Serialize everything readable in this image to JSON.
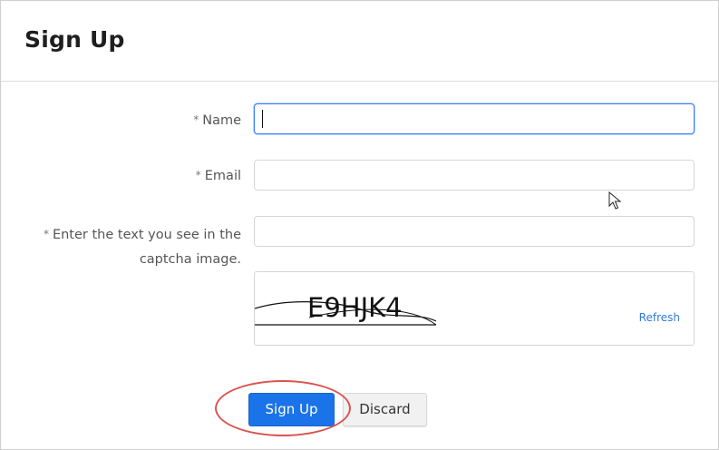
{
  "page": {
    "title": "Sign Up"
  },
  "form": {
    "required_marker": "*",
    "name_label": "Name",
    "name_value": "",
    "email_label": "Email",
    "email_value": "",
    "captcha_label": "Enter the text you see in the captcha image.",
    "captcha_value": "",
    "captcha_text": "E9HJK4",
    "refresh_label": "Refresh"
  },
  "actions": {
    "signup_label": "Sign Up",
    "discard_label": "Discard"
  },
  "colors": {
    "primary": "#1a73e8",
    "focus_border": "#3b82f6",
    "link": "#2f7bd8",
    "highlight": "#d9534f"
  }
}
